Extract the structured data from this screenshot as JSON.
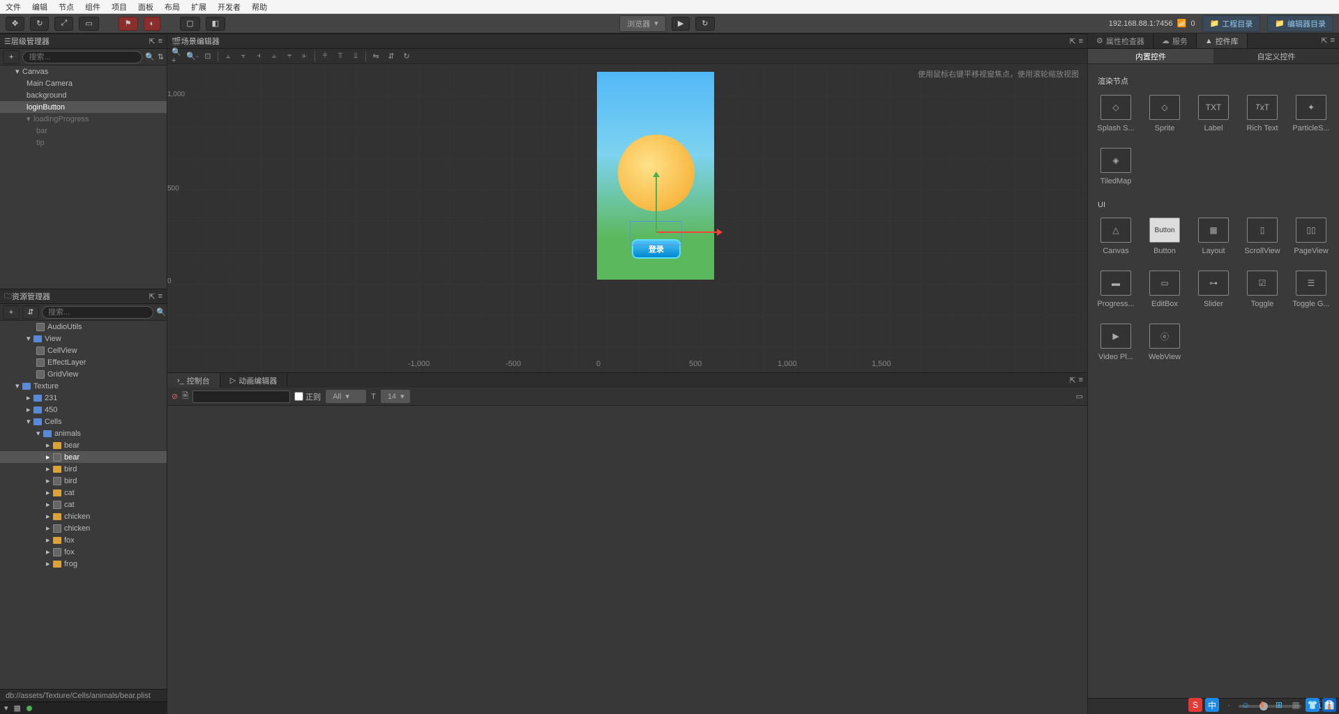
{
  "menu": [
    "文件",
    "编辑",
    "节点",
    "组件",
    "项目",
    "面板",
    "布局",
    "扩展",
    "开发者",
    "帮助"
  ],
  "toolbar": {
    "preview_label": "浏览器",
    "ip": "192.168.88.1:7456",
    "conn_count": "0",
    "project_dir": "工程目录",
    "editor_dir": "编辑器目录"
  },
  "panels": {
    "hierarchy": "层级管理器",
    "scene": "场景编辑器",
    "assets": "资源管理器",
    "console": "控制台",
    "anim": "动画编辑器",
    "inspector": "属性检查器",
    "services": "服务",
    "widgets": "控件库"
  },
  "search_placeholder": "搜索...",
  "hierarchy_tree": {
    "root": "Canvas",
    "items": [
      "Main Camera",
      "background",
      "loginButton",
      "loadingProgress",
      "bar",
      "tip"
    ]
  },
  "scene": {
    "hint": "使用鼠标右键平移视窗焦点，使用滚轮缩放视图",
    "yscale": [
      "1,000",
      "500",
      "0"
    ],
    "xscale": [
      "-1,000",
      "-500",
      "0",
      "500",
      "1,000",
      "1,500"
    ],
    "play_btn": "登录"
  },
  "assets": {
    "items": {
      "audio": "AudioUtils",
      "view": "View",
      "cellview": "CellView",
      "effectlayer": "EffectLayer",
      "gridview": "GridView",
      "texture": "Texture",
      "n231": "231",
      "n450": "450",
      "cells": "Cells",
      "animals": "animals",
      "bear1": "bear",
      "bear2": "bear",
      "bird1": "bird",
      "bird2": "bird",
      "cat1": "cat",
      "cat2": "cat",
      "chicken1": "chicken",
      "chicken2": "chicken",
      "fox1": "fox",
      "fox2": "fox",
      "frog": "frog"
    }
  },
  "console": {
    "regex": "正则",
    "level": "All",
    "font_size": "14"
  },
  "status_path": "db://assets/Texture/Cells/animals/bear.plist",
  "right": {
    "sub_builtin": "内置控件",
    "sub_custom": "自定义控件",
    "sec_render": "渲染节点",
    "sec_ui": "UI",
    "render_widgets": [
      "Splash S...",
      "Sprite",
      "Label",
      "Rich Text",
      "ParticleS...",
      "TiledMap"
    ],
    "ui_widgets": [
      "Canvas",
      "Button",
      "Layout",
      "ScrollView",
      "PageView",
      "Progress...",
      "EditBox",
      "Slider",
      "Toggle",
      "Toggle G...",
      "Video Pl...",
      "WebView"
    ],
    "zoom": "1"
  }
}
